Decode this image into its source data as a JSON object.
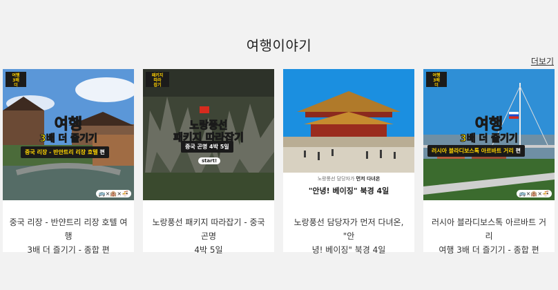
{
  "section": {
    "title": "여행이야기",
    "more_label": "더보기"
  },
  "cards": [
    {
      "badge": "여행\n3배",
      "overlay_title_1": "여행",
      "overlay_title_2": "3배 더 즐기기",
      "overlay_banner": "중국 리장 - 반얀트리 리장 호텔",
      "overlay_banner_suffix": "편",
      "icons": "🚌×🏨×🍜",
      "caption_line1": "중국 리장 - 반얀트리 리장 호텔 여행",
      "caption_line2": "3배 더 즐기기 - 종합 편"
    },
    {
      "badge": "패키지\n따라\n잡기",
      "overlay_title_1": "노랑풍선",
      "overlay_title_2": "패키지 따라잡기",
      "overlay_banner": "중국 곤명 4박 5일",
      "start_label": "start!",
      "caption_line1": "노랑풍선 패키지 따라잡기 - 중국 곤명",
      "caption_line2": "4박 5일"
    },
    {
      "overlay_small": "노랑풍선 담당자가",
      "overlay_small_bold": "먼저 다녀온",
      "overlay_quote": "\"안녕! 베이징\"",
      "overlay_trip": "북경 4일",
      "caption_line1": "노랑풍선 담당자가 먼저 다녀온, \"안",
      "caption_line2": "녕! 베이징\" 북경 4일"
    },
    {
      "badge": "여행\n3배",
      "overlay_title_1": "여행",
      "overlay_title_2": "3배 더 즐기기",
      "overlay_banner": "러시아 블라디보스톡 아르바트 거리",
      "overlay_banner_suffix": "편",
      "icons": "🚌×🏨×🍜",
      "caption_line1": "러시아 블라디보스톡 아르바트 거리",
      "caption_line2": "여행 3배 더 즐기기 - 종합 편"
    }
  ]
}
